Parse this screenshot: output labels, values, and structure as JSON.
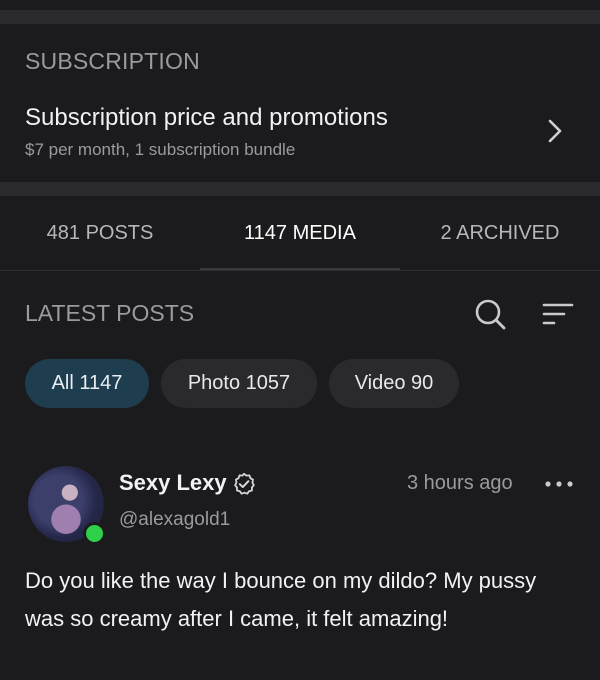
{
  "subscription": {
    "section_title": "SUBSCRIPTION",
    "row_title": "Subscription price and promotions",
    "row_desc": "$7 per month, 1 subscription bundle",
    "chevron_icon": "chevron-right-icon"
  },
  "tabs": [
    {
      "label": "481 POSTS"
    },
    {
      "label": "1147 MEDIA"
    },
    {
      "label": "2 ARCHIVED"
    }
  ],
  "latest": {
    "title": "LATEST POSTS",
    "search_icon": "search-icon",
    "filter_icon": "sort-filter-icon"
  },
  "chips": [
    {
      "label": "All 1147",
      "active": true
    },
    {
      "label": "Photo 1057",
      "active": false
    },
    {
      "label": "Video 90",
      "active": false
    }
  ],
  "post": {
    "author_name": "Sexy Lexy",
    "handle": "@alexagold1",
    "time": "3 hours ago",
    "text": "Do you like the way I bounce on my dildo? My pussy was so creamy after I came, it felt amazing!",
    "verified_icon": "verified-badge-icon",
    "more_icon": "more-dots-icon",
    "online_color": "#2ed04a"
  },
  "colors": {
    "background": "#1b1b1d",
    "divider": "#2a2a2d",
    "active_chip": "#1e3d4f",
    "muted_text": "#9a9aa0"
  }
}
